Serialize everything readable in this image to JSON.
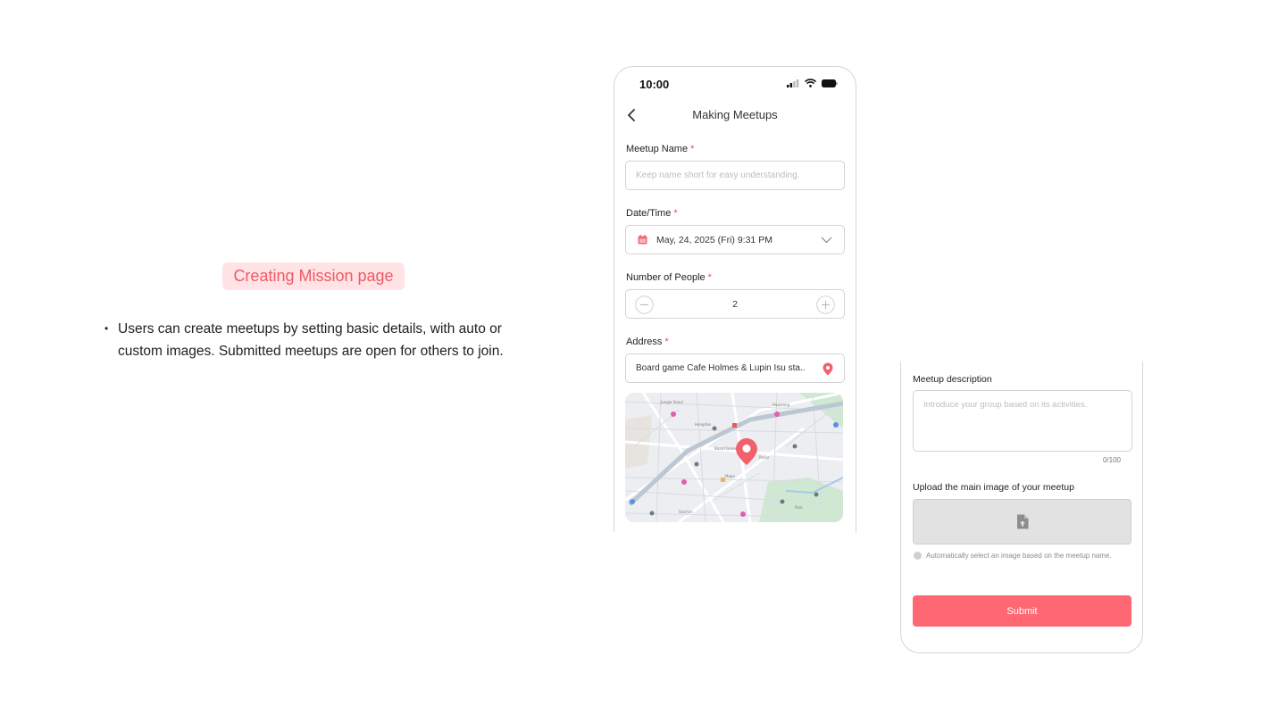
{
  "intro": {
    "badge": "Creating Mission page",
    "bullet": "Users can create meetups by setting basic details, with auto or custom images. Submitted meetups are open for others to join."
  },
  "status_bar": {
    "time": "10:00"
  },
  "header": {
    "title": "Making Meetups"
  },
  "form": {
    "name": {
      "label": "Meetup Name",
      "required": "*",
      "placeholder": "Keep name short for easy understanding."
    },
    "datetime": {
      "label": "Date/Time",
      "required": "*",
      "value": "May, 24, 2025 (Fri)  9:31 PM"
    },
    "people": {
      "label": "Number of People",
      "required": "*",
      "value": "2"
    },
    "address": {
      "label": "Address",
      "required": "*",
      "value": "Board game Cafe Holmes & Lupin Isu sta.."
    },
    "description": {
      "label": "Meetup description",
      "placeholder": "Introduce your group based on its activities.",
      "counter": "0/100"
    },
    "image": {
      "label": "Upload the main image of your meetup",
      "auto_label": "Automatically select an image based on the meetup name."
    },
    "submit_label": "Submit"
  },
  "colors": {
    "accent": "#ff6772",
    "badge_bg": "#ffe3e5",
    "badge_text": "#ee5a66"
  }
}
